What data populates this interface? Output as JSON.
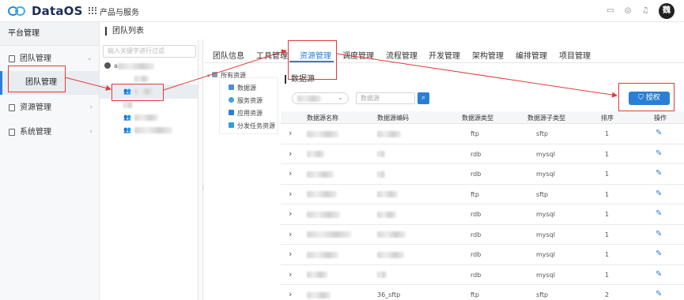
{
  "app": {
    "brand": "DataOS",
    "products": "产品与服务",
    "avatar": "魏"
  },
  "topbar_icons": [
    "mail-icon",
    "database-icon",
    "bell-icon"
  ],
  "sidebar": {
    "title": "平台管理",
    "items": [
      {
        "label": "团队管理",
        "icon": "team-icon",
        "expanded": true
      },
      {
        "label": "资源管理",
        "icon": "resource-icon"
      },
      {
        "label": "系统管理",
        "icon": "system-icon"
      }
    ],
    "sub_item": "团队管理"
  },
  "breadcrumb": "团队列表",
  "tree": {
    "placeholder": "输入关键字进行过滤",
    "root_prefix": "a"
  },
  "tabs": [
    "团队信息",
    "工具管理",
    "资源管理",
    "调度管理",
    "流程管理",
    "开发管理",
    "架构管理",
    "编排管理",
    "项目管理"
  ],
  "active_tab": "资源管理",
  "resource_tree": {
    "root": "所有资源",
    "children": [
      "数据源",
      "服务资源",
      "应用资源",
      "分发任务资源"
    ]
  },
  "datasource": {
    "title": "数据源",
    "search_placeholder": "数据源",
    "authorize_button": "授权"
  },
  "table": {
    "headers": [
      "数据源名称",
      "数据源编码",
      "数据源类型",
      "数据源子类型",
      "排序",
      "操作"
    ],
    "rows": [
      {
        "code_prefix": "",
        "type": "ftp",
        "subtype": "sftp",
        "order": "1"
      },
      {
        "code_prefix": "",
        "type": "rdb",
        "subtype": "mysql",
        "order": "1"
      },
      {
        "code_prefix": "",
        "type": "rdb",
        "subtype": "mysql",
        "order": "1"
      },
      {
        "code_prefix": "",
        "type": "ftp",
        "subtype": "sftp",
        "order": "1"
      },
      {
        "code_prefix": "",
        "type": "rdb",
        "subtype": "mysql",
        "order": "1"
      },
      {
        "code_prefix": "",
        "type": "rdb",
        "subtype": "mysql",
        "order": "1"
      },
      {
        "code_prefix": "",
        "type": "rdb",
        "subtype": "mysql",
        "order": "1"
      },
      {
        "code_prefix": "",
        "type": "rdb",
        "subtype": "mysql",
        "order": "1"
      },
      {
        "code_prefix": "36_sftp",
        "type": "ftp",
        "subtype": "sftp",
        "order": "2"
      }
    ]
  },
  "colors": {
    "accent": "#2a7fd4",
    "annotation": "#e23b3b"
  }
}
